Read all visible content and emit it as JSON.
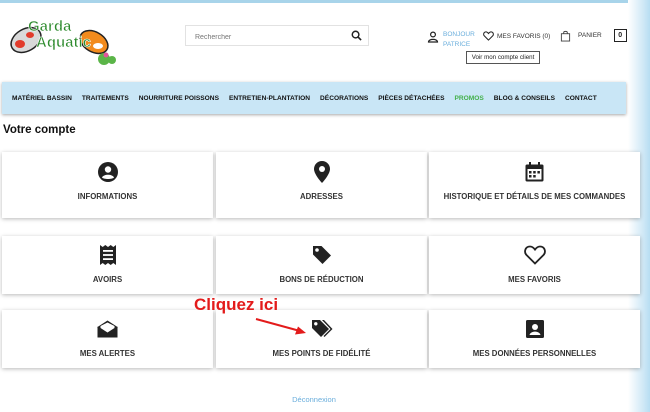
{
  "brand": {
    "line1": "Garda",
    "line2": "Aquatic"
  },
  "search": {
    "placeholder": "Rechercher"
  },
  "header": {
    "account_line1": "Bonjour",
    "account_line2": "Patrice",
    "favorites_label": "Mes favoris (0)",
    "cart_label": "Panier",
    "cart_count": "0",
    "tooltip": "Voir mon compte client"
  },
  "nav": [
    "Matériel bassin",
    "Traitements",
    "Nourriture poissons",
    "Entretien-Plantation",
    "Décorations",
    "Pièces détachées",
    "Promos",
    "Blog & Conseils",
    "Contact"
  ],
  "page_title": "Votre compte",
  "cards": [
    {
      "label": "Informations",
      "icon": "user-circle-icon"
    },
    {
      "label": "Adresses",
      "icon": "map-pin-icon"
    },
    {
      "label": "Historique et détails de mes commandes",
      "icon": "calendar-icon"
    },
    {
      "label": "Avoirs",
      "icon": "receipt-icon"
    },
    {
      "label": "Bons de réduction",
      "icon": "tag-icon"
    },
    {
      "label": "Mes favoris",
      "icon": "heart-icon"
    },
    {
      "label": "Mes alertes",
      "icon": "envelope-icon"
    },
    {
      "label": "Mes points de fidélité",
      "icon": "tags-icon"
    },
    {
      "label": "Mes données personnelles",
      "icon": "id-card-icon"
    }
  ],
  "annotation": "Cliquez ici",
  "logout": "Déconnexion",
  "colors": {
    "nav_bg": "#c9e6f6",
    "accent_blue": "#6aaedc",
    "promo_green": "#43b04a",
    "annotation_red": "#e31b1b"
  }
}
